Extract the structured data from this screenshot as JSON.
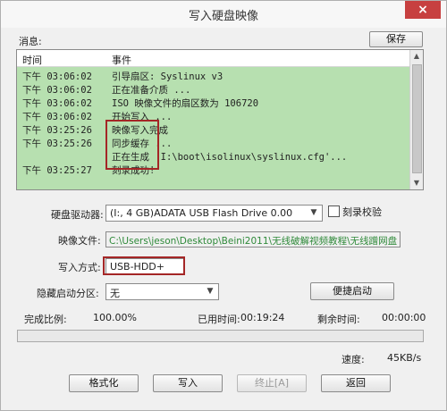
{
  "window": {
    "title": "写入硬盘映像",
    "close_symbol": "×"
  },
  "messages": {
    "label": "消息:",
    "save_button": "保存",
    "columns": [
      "时间",
      "事件"
    ],
    "rows": [
      {
        "time": "下午 03:06:02",
        "event": "引导扇区: Syslinux v3"
      },
      {
        "time": "下午 03:06:02",
        "event": "正在准备介质 ..."
      },
      {
        "time": "下午 03:06:02",
        "event": "ISO 映像文件的扇区数为 106720"
      },
      {
        "time": "下午 03:06:02",
        "event": "开始写入 ..."
      },
      {
        "time": "下午 03:25:26",
        "event": "映像写入完成"
      },
      {
        "time": "下午 03:25:26",
        "event": "同步缓存 ..."
      },
      {
        "time": "",
        "event": "正在生成 'I:\\boot\\isolinux\\syslinux.cfg'..."
      },
      {
        "time": "下午 03:25:27",
        "event": "刻录成功!"
      }
    ]
  },
  "drive": {
    "label": "硬盘驱动器:",
    "value": "(I:, 4 GB)ADATA   USB Flash Drive 0.00",
    "verify_label": "刻录校验"
  },
  "image": {
    "label": "映像文件:",
    "path": "C:\\Users\\jeson\\Desktop\\Beini2011\\无线破解视频教程\\无线蹭网盘"
  },
  "write_mode": {
    "label": "写入方式:",
    "value": "USB-HDD+"
  },
  "hidden_partition": {
    "label": "隐藏启动分区:",
    "value": "无",
    "quick_boot_button": "便捷启动"
  },
  "stats": {
    "completion_label": "完成比例:",
    "completion_value": "100.00%",
    "elapsed_label": "已用时间:",
    "elapsed_value": "00:19:24",
    "remaining_label": "剩余时间:",
    "remaining_value": "00:00:00",
    "speed_label": "速度:",
    "speed_value": "45KB/s",
    "progress_fraction": 1.0
  },
  "buttons": {
    "format": "格式化",
    "write": "写入",
    "stop": "终止[A]",
    "back": "返回"
  },
  "colors": {
    "log_background": "#b7e0b0",
    "path_text": "#2f8a3a",
    "highlight": "#a42626"
  }
}
